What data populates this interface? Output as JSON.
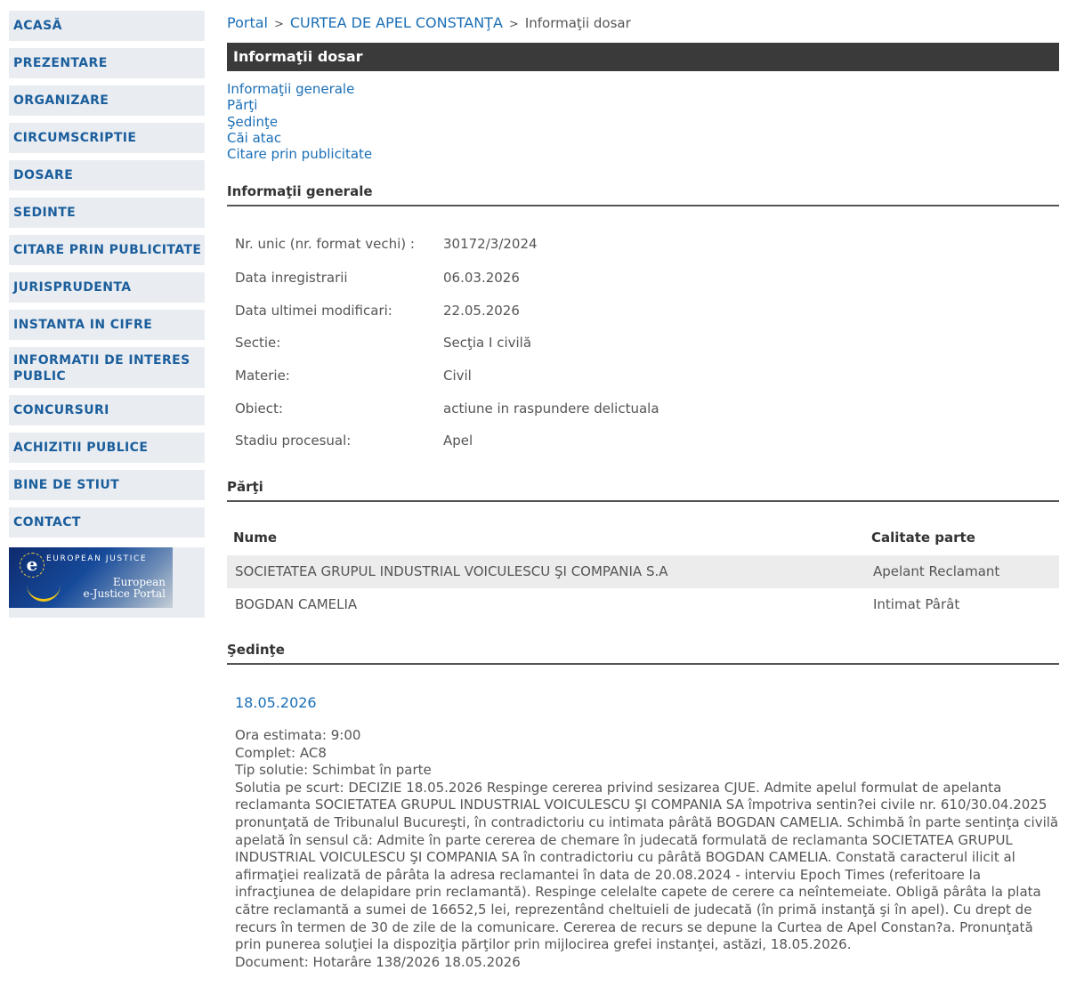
{
  "sidebar": {
    "items": [
      {
        "label": "ACASĂ"
      },
      {
        "label": "PREZENTARE"
      },
      {
        "label": "ORGANIZARE"
      },
      {
        "label": "CIRCUMSCRIPTIE"
      },
      {
        "label": "DOSARE"
      },
      {
        "label": "SEDINTE"
      },
      {
        "label": "CITARE PRIN PUBLICITATE"
      },
      {
        "label": "JURISPRUDENTA"
      },
      {
        "label": "INSTANTA IN CIFRE"
      },
      {
        "label": "INFORMATII DE INTERES PUBLIC"
      },
      {
        "label": "CONCURSURI"
      },
      {
        "label": "ACHIZITII PUBLICE"
      },
      {
        "label": "BINE DE STIUT"
      },
      {
        "label": "CONTACT"
      }
    ],
    "banner": {
      "top": "EUROPEAN JUSTICE",
      "line1": "European",
      "line2": "e-Justice Portal"
    }
  },
  "breadcrumb": {
    "home": "Portal",
    "court": "CURTEA DE APEL CONSTANŢA",
    "current": "Informaţii dosar",
    "sep": ">"
  },
  "page": {
    "title": "Informaţii dosar"
  },
  "anchors": [
    "Informaţii generale",
    "Părţi",
    "Şedinţe",
    "Căi atac",
    "Citare prin publicitate"
  ],
  "general": {
    "heading": "Informaţii generale",
    "rows": [
      {
        "label": "Nr. unic (nr. format vechi) :",
        "value": "30172/3/2024"
      },
      {
        "label": "Data inregistrarii",
        "value": "06.03.2026"
      },
      {
        "label": "Data ultimei modificari:",
        "value": "22.05.2026"
      },
      {
        "label": "Sectie:",
        "value": "Secţia I civilă"
      },
      {
        "label": "Materie:",
        "value": "Civil"
      },
      {
        "label": "Obiect:",
        "value": "actiune in raspundere delictuala"
      },
      {
        "label": "Stadiu procesual:",
        "value": "Apel"
      }
    ]
  },
  "parties": {
    "heading": "Părţi",
    "col_name": "Nume",
    "col_role": "Calitate parte",
    "rows": [
      {
        "name": "SOCIETATEA GRUPUL INDUSTRIAL VOICULESCU ŞI COMPANIA S.A",
        "role": "Apelant Reclamant"
      },
      {
        "name": "BOGDAN CAMELIA",
        "role": "Intimat Pârât"
      }
    ]
  },
  "sessions": {
    "heading": "Şedinţe",
    "date": "18.05.2026",
    "ora": "Ora estimata: 9:00",
    "complet": "Complet: AC8",
    "tip": "Tip solutie: Schimbat în parte",
    "solutie": "Solutia pe scurt: DECIZIE 18.05.2026 Respinge cererea privind sesizarea CJUE. Admite apelul formulat de apelanta reclamanta SOCIETATEA GRUPUL INDUSTRIAL VOICULESCU ŞI COMPANIA SA împotriva sentin?ei civile nr. 610/30.04.2025 pronunţată de Tribunalul Bucureşti, în contradictoriu cu intimata pârâtă BOGDAN CAMELIA. Schimbă în parte sentinţa civilă apelată în sensul că: Admite în parte cererea de chemare în judecată formulată de reclamanta SOCIETATEA GRUPUL INDUSTRIAL VOICULESCU ŞI COMPANIA SA în contradictoriu cu pârâtă BOGDAN CAMELIA. Constată caracterul ilicit al afirmaţiei realizată de pârâta la adresa reclamantei în data de 20.08.2024 - interviu Epoch Times (referitoare la infracţiunea de delapidare prin reclamantă). Respinge celelalte capete de cerere ca neîntemeiate. Obligă pârâta la plata către reclamantă a sumei de 16652,5 lei, reprezentând cheltuieli de judecată (în primă instanţă şi în apel). Cu drept de recurs în termen de 30 de zile de la comunicare. Cererea de recurs se depune la Curtea de Apel Constan?a. Pronunţată prin punerea soluţiei la dispoziţia părţilor prin mijlocirea grefei instanţei, astăzi, 18.05.2026.",
    "document": "Document: Hotarâre  138/2026  18.05.2026"
  }
}
